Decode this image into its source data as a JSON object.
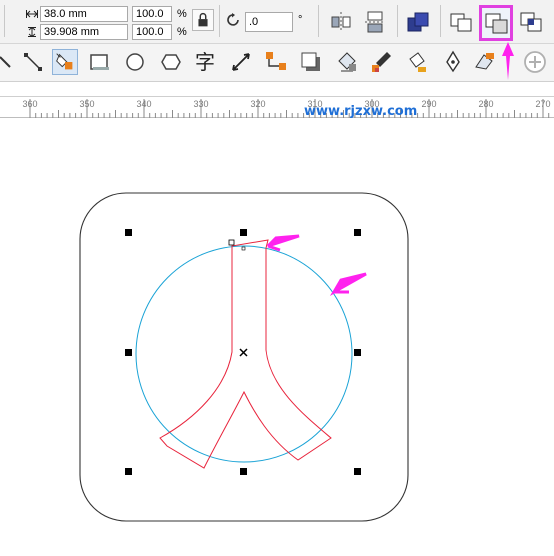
{
  "property_bar": {
    "width_value": "38.0 mm",
    "height_value": "39.908 mm",
    "scale_x": "100.0",
    "scale_y": "100.0",
    "percent_symbol_x": "%",
    "percent_symbol_y": "%",
    "rotation_value": ".0",
    "degree_symbol": "°"
  },
  "ruler": {
    "labels": [
      "360",
      "350",
      "340",
      "330",
      "320",
      "310",
      "300",
      "290",
      "280",
      "270"
    ]
  },
  "watermark": "www.rjzxw.com",
  "tool_glyphs": {
    "text_tool": "字"
  },
  "colors": {
    "highlight": "#e040e0",
    "annotation_arrow": "#ff22ee",
    "circle_stroke": "#1aa3d6",
    "shape_stroke": "#e8243c",
    "rounded_rect_stroke": "#333333",
    "watermark": "#1f6fd6"
  }
}
